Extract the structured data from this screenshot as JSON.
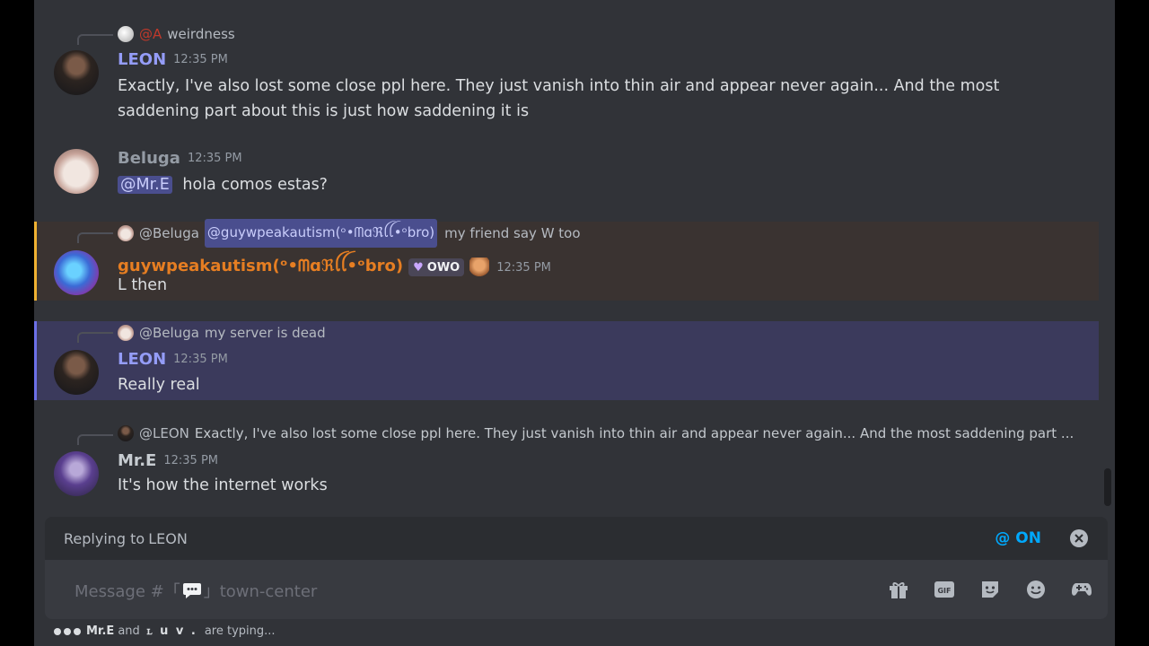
{
  "channel": {
    "composer_placeholder_prefix": "Message #「",
    "composer_placeholder_suffix": "」town-center"
  },
  "messages": [
    {
      "reply": {
        "name": "@A",
        "text": "weirdness"
      },
      "author": "LEON",
      "color": "#949cf7",
      "time": "12:35 PM",
      "text": "Exactly, I've also lost some close ppl here. They just vanish into thin air and appear never again...  And the most saddening part about this is just how saddening it is"
    },
    {
      "author": "Beluga",
      "color": "#949ba4",
      "time": "12:35 PM",
      "mention": "@Mr.E",
      "text": "hola comos estas?"
    },
    {
      "reply": {
        "name": "@Beluga",
        "mention": "@guywpeakautism(ᵒ•ᗰɑℜꪶꪶ•ᵒbro)",
        "text": "my friend say W too"
      },
      "author": "guywpeakautism(ᵒ•ᗰɑℜꪶꪶ•ᵒbro)",
      "color": "#e67e22",
      "badge": "OWO",
      "time": "12:35 PM",
      "text": "L then"
    },
    {
      "reply": {
        "name": "@Beluga",
        "text": "my server is dead"
      },
      "author": "LEON",
      "color": "#949cf7",
      "time": "12:35 PM",
      "text": "Really real"
    },
    {
      "reply": {
        "name": "@LEON",
        "text": "Exactly, I've also lost some close ppl here. They just vanish into thin air and appear never again...  And the most saddening part ..."
      },
      "author": "Mr.E",
      "color": "#c7ccd1",
      "time": "12:35 PM",
      "text": "It's how the internet works"
    }
  ],
  "reply_bar": {
    "prefix": "Replying to ",
    "target": "LEON",
    "ping": "@ ON"
  },
  "toolbar": {
    "icons": [
      "gift-icon",
      "gif-icon",
      "sticker-icon",
      "emoji-icon",
      "activities-icon"
    ]
  },
  "typing": {
    "user1": "Mr.E",
    "and": "and",
    "user2": "ꮮ u v .",
    "suffix": "are typing..."
  },
  "colors": {
    "accent": "#5865f2",
    "link": "#00a8fc",
    "mention_bg": "#4a4e8e"
  }
}
